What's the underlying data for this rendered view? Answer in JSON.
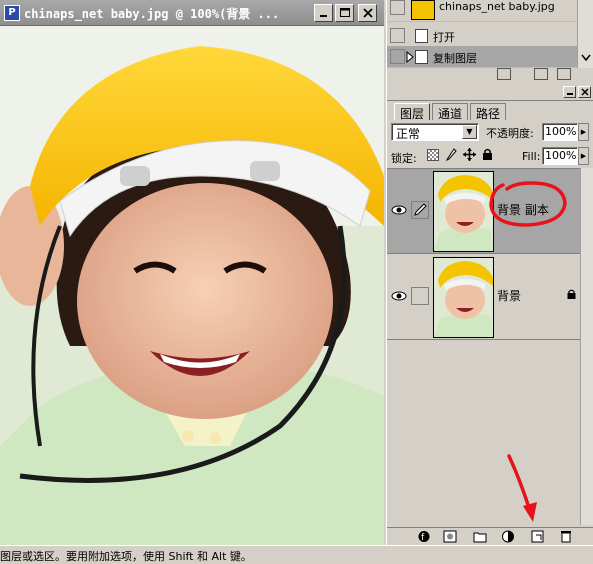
{
  "document": {
    "title": "chinaps_net baby.jpg @ 100%(背景 ...",
    "icon": "photoshop-icon",
    "buttons": [
      "minimize-icon",
      "maximize-icon",
      "close-icon"
    ]
  },
  "history": {
    "snapshot_label": "chinaps_net baby.jpg",
    "items": [
      {
        "label": "打开",
        "selected": false
      },
      {
        "label": "复制图层",
        "selected": true
      }
    ]
  },
  "layers_panel": {
    "tabs": [
      "图层",
      "通道",
      "路径"
    ],
    "active_tab": "图层",
    "blend_mode": "正常",
    "opacity_label": "不透明度:",
    "opacity_value": "100%",
    "lock_label": "锁定:",
    "fill_label": "Fill:",
    "fill_value": "100%",
    "layers": [
      {
        "name": "背景 副本",
        "selected": true,
        "visible": true,
        "locked": false
      },
      {
        "name": "背景",
        "selected": false,
        "visible": true,
        "locked": true
      }
    ]
  },
  "status": {
    "text": "图层或选区。要用附加选项，使用 Shift 和 Alt 键。"
  },
  "colors": {
    "annotation": "#e8121b",
    "selected_layer": "#a7a6a6",
    "titlebar": "#9a9a9a"
  }
}
